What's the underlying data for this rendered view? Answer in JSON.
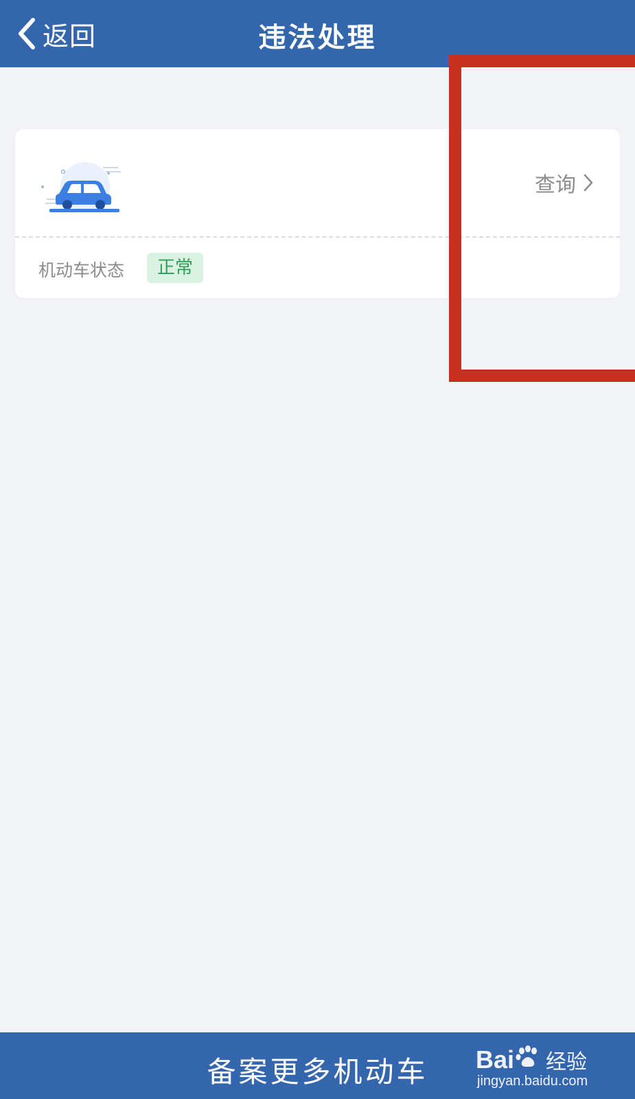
{
  "header": {
    "back_label": "返回",
    "title": "违法处理"
  },
  "vehicle_card": {
    "query_label": "查询",
    "status_label": "机动车状态",
    "status_value": "正常"
  },
  "bottom_bar": {
    "label": "备案更多机动车"
  },
  "watermark": {
    "brand_prefix": "Bai",
    "brand_suffix": "经验",
    "url": "jingyan.baidu.com"
  },
  "colors": {
    "header_blue": "#3466ad",
    "background": "#f2f3f7",
    "status_green": "#2f9e5a",
    "status_badge_bg": "#d9f2e2",
    "annotation_red": "#c7301e",
    "car_blue": "#3b7fe3"
  },
  "icons": {
    "back": "chevron-left-icon",
    "query": "chevron-right-icon",
    "car": "car-icon"
  }
}
